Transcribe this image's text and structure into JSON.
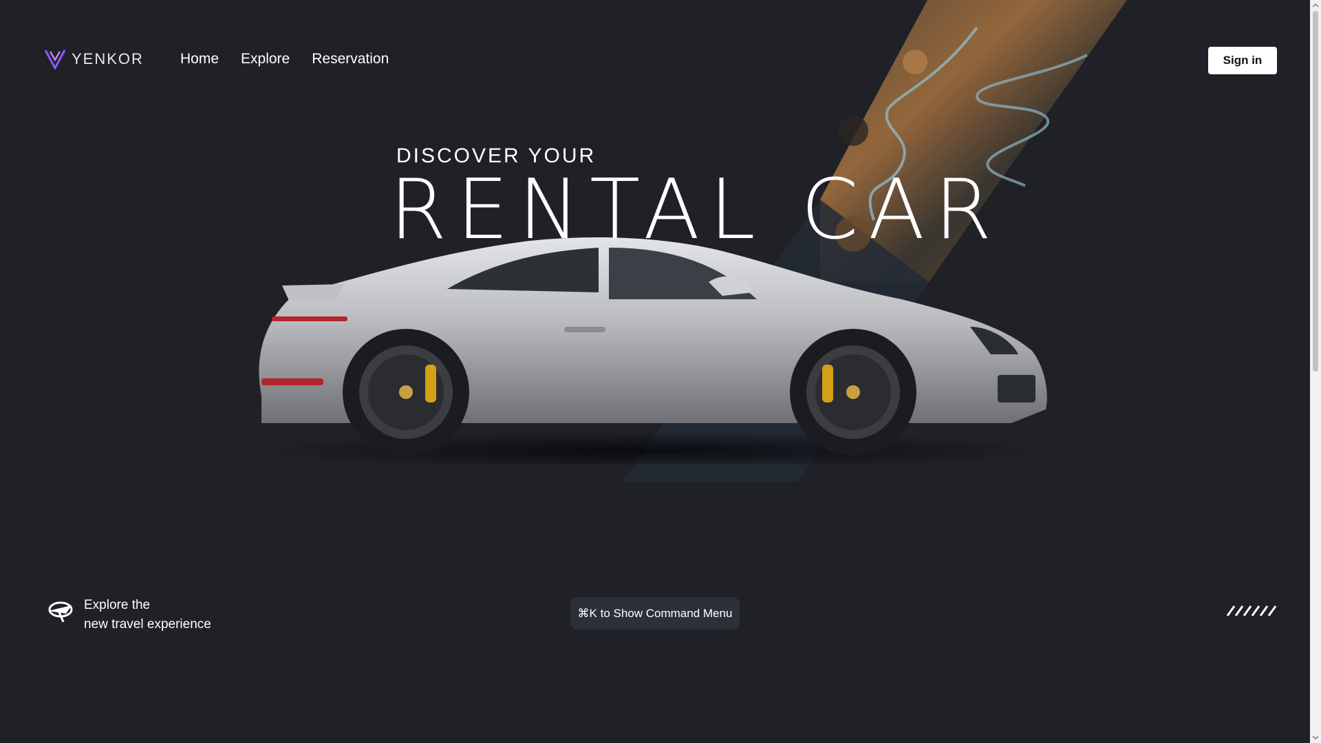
{
  "header": {
    "logo_text": "YENKOR",
    "nav": [
      {
        "label": "Home"
      },
      {
        "label": "Explore"
      },
      {
        "label": "Reservation"
      }
    ],
    "signin_label": "Sign in"
  },
  "hero": {
    "eyebrow": "DISCOVER YOUR",
    "title": "RENTAL CAR"
  },
  "footer": {
    "tagline_line1": "Explore the",
    "tagline_line2": "new travel experience",
    "command_hint": "⌘K to Show Command Menu"
  },
  "icons": {
    "logo": "yenkor-logo-icon",
    "explore": "plane-globe-icon",
    "decor": "slashes-icon"
  },
  "colors": {
    "background": "#1f2127",
    "logo_accent": "#8b5cf6",
    "car_body": "#c9cbce",
    "caliper": "#d4a017"
  }
}
